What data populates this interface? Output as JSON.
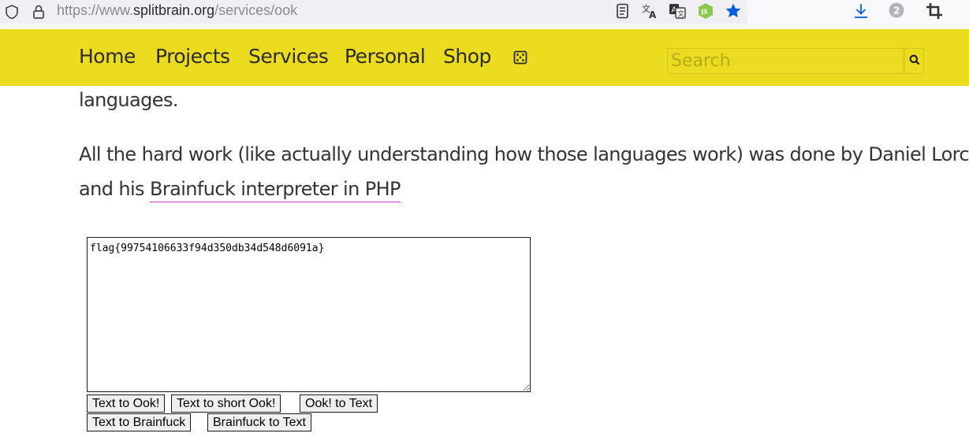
{
  "browser": {
    "url_prefix": "https://www.",
    "url_host": "splitbrain.org",
    "url_path": "/services/ook",
    "profile_badge": "2"
  },
  "nav": {
    "items": [
      "Home",
      "Projects",
      "Services",
      "Personal",
      "Shop"
    ],
    "random_icon": "dice-icon",
    "search_placeholder": "Search"
  },
  "content": {
    "line1": "languages.",
    "line2": "All the hard work (like actually understanding how those languages work) was done by Daniel Lorch",
    "line3_prefix": "and his ",
    "link_text": "Brainfuck interpreter in PHP"
  },
  "form": {
    "textarea_value": "flag{99754106633f94d350db34d548d6091a}",
    "buttons": [
      "Text to Ook!",
      "Text to short Ook!",
      "Ook! to Text",
      "Text to Brainfuck",
      "Brainfuck to Text"
    ]
  },
  "colors": {
    "nav_background": "#ecdc20",
    "link_underline": "#d63bd6",
    "bookmark_star": "#0061e0",
    "node_extension": "#8cc84b"
  }
}
